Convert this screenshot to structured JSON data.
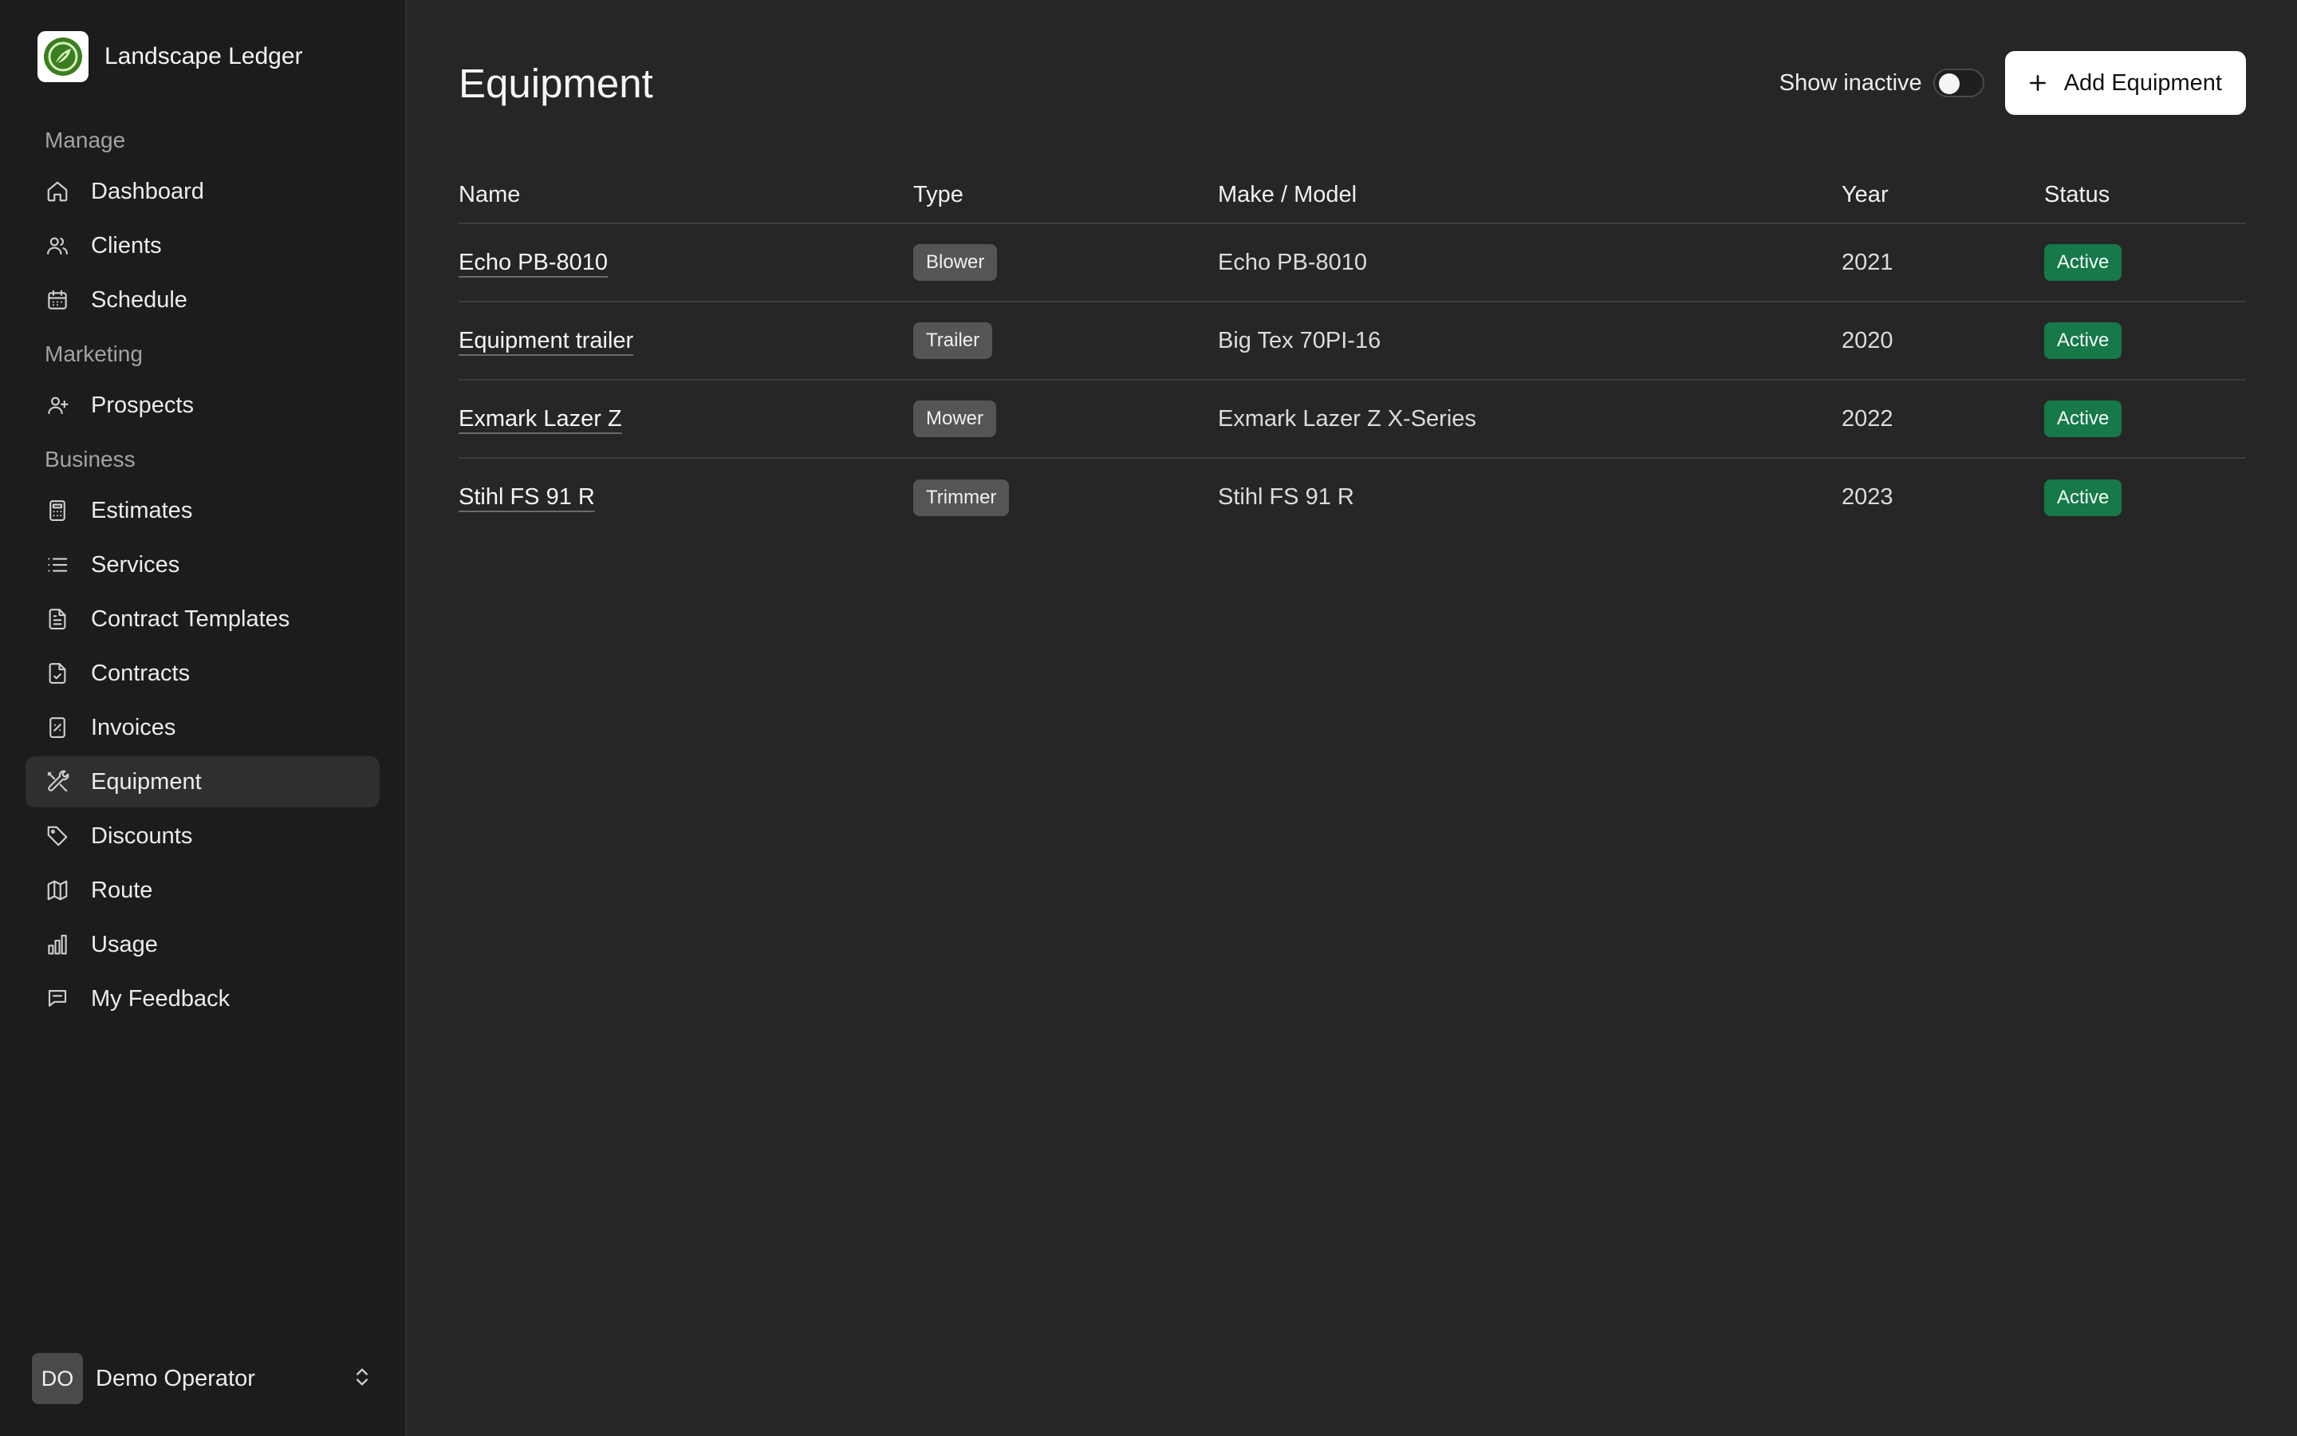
{
  "app": {
    "name": "Landscape Ledger"
  },
  "sidebar": {
    "sections": [
      {
        "label": "Manage",
        "items": [
          {
            "label": "Dashboard",
            "icon": "home-icon"
          },
          {
            "label": "Clients",
            "icon": "users-icon"
          },
          {
            "label": "Schedule",
            "icon": "calendar-icon"
          }
        ]
      },
      {
        "label": "Marketing",
        "items": [
          {
            "label": "Prospects",
            "icon": "user-plus-icon"
          }
        ]
      },
      {
        "label": "Business",
        "items": [
          {
            "label": "Estimates",
            "icon": "calculator-icon"
          },
          {
            "label": "Services",
            "icon": "list-icon"
          },
          {
            "label": "Contract Templates",
            "icon": "file-text-icon"
          },
          {
            "label": "Contracts",
            "icon": "file-check-icon"
          },
          {
            "label": "Invoices",
            "icon": "receipt-icon"
          },
          {
            "label": "Equipment",
            "icon": "tools-icon",
            "active": true
          },
          {
            "label": "Discounts",
            "icon": "tag-icon"
          },
          {
            "label": "Route",
            "icon": "map-icon"
          },
          {
            "label": "Usage",
            "icon": "bar-chart-icon"
          },
          {
            "label": "My Feedback",
            "icon": "message-icon"
          }
        ]
      }
    ],
    "user": {
      "initials": "DO",
      "name": "Demo Operator"
    }
  },
  "header": {
    "title": "Equipment",
    "show_inactive_label": "Show inactive",
    "show_inactive": false,
    "add_label": "Add Equipment"
  },
  "table": {
    "columns": [
      "Name",
      "Type",
      "Make / Model",
      "Year",
      "Status"
    ],
    "rows": [
      {
        "name": "Echo PB-8010",
        "type": "Blower",
        "make_model": "Echo PB-8010",
        "year": "2021",
        "status": "Active"
      },
      {
        "name": "Equipment trailer",
        "type": "Trailer",
        "make_model": "Big Tex 70PI-16",
        "year": "2020",
        "status": "Active"
      },
      {
        "name": "Exmark Lazer Z",
        "type": "Mower",
        "make_model": "Exmark Lazer Z X-Series",
        "year": "2022",
        "status": "Active"
      },
      {
        "name": "Stihl FS 91 R",
        "type": "Trimmer",
        "make_model": "Stihl FS 91 R",
        "year": "2023",
        "status": "Active"
      }
    ]
  },
  "colors": {
    "accent_status": "#17784a",
    "brand_green": "#3a7d1e"
  }
}
